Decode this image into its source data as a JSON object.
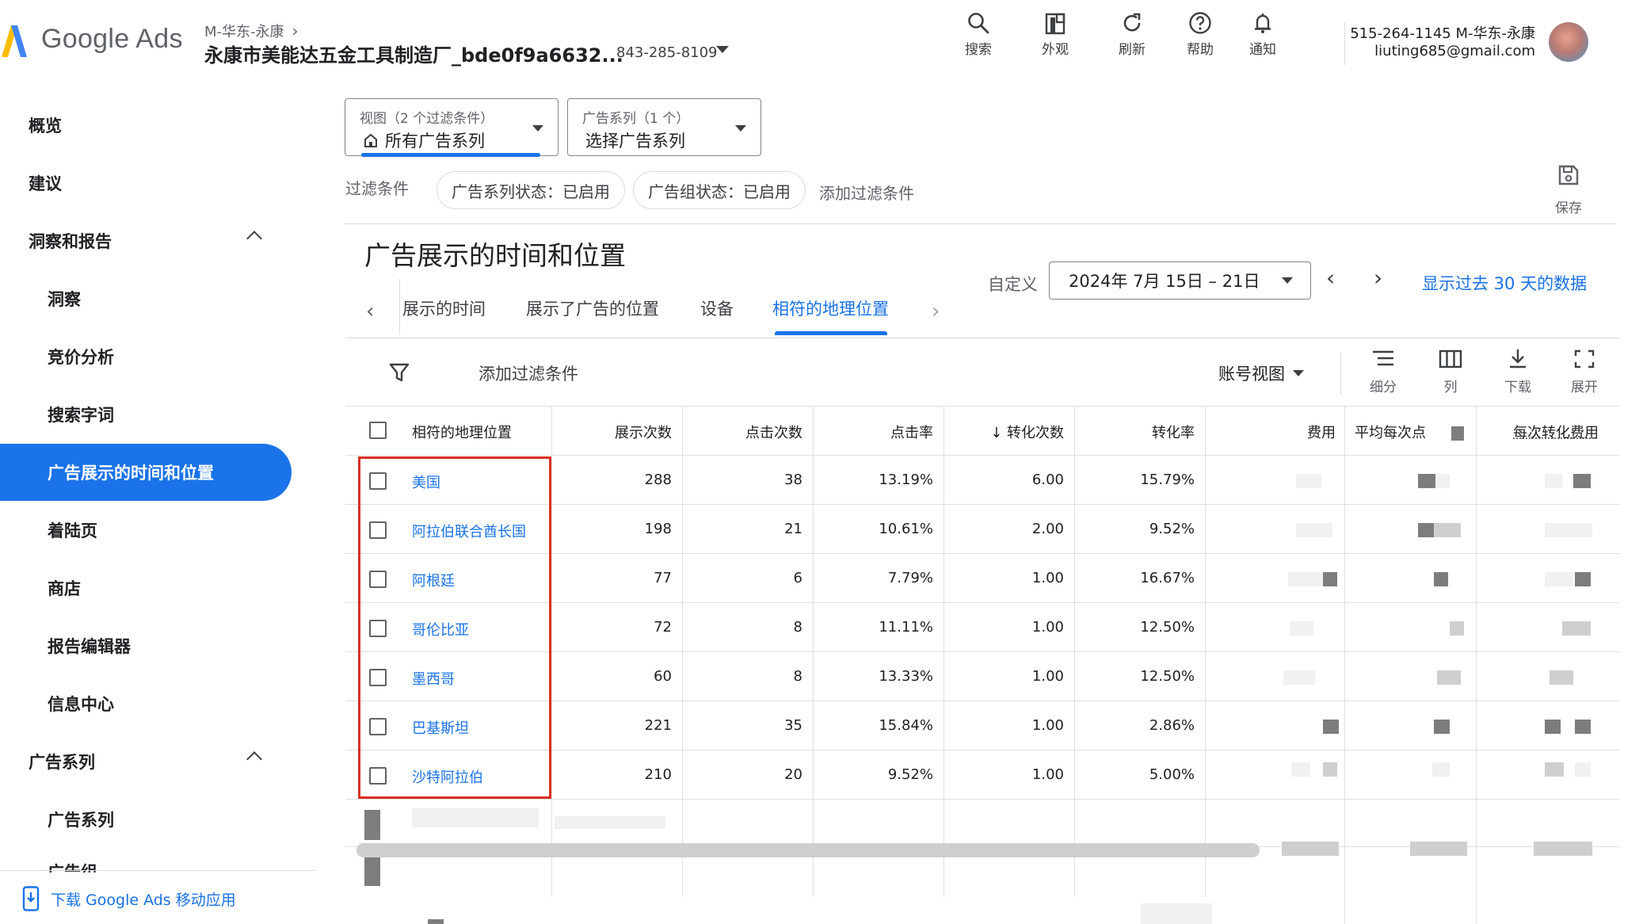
{
  "header": {
    "logo_text": "Google Ads",
    "account_crumb": "M-华东-永康",
    "account_name": "永康市美能达五金工具制造厂_bde0f9a6632...",
    "account_id": "843-285-8109",
    "tools": [
      {
        "label": "搜索",
        "icon": "search-icon"
      },
      {
        "label": "外观",
        "icon": "appearance-icon"
      },
      {
        "label": "刷新",
        "icon": "refresh-icon"
      },
      {
        "label": "帮助",
        "icon": "help-icon"
      },
      {
        "label": "通知",
        "icon": "bell-icon"
      }
    ],
    "user_line1": "515-264-1145 M-华东-永康",
    "user_email": "liuting685@gmail.com"
  },
  "sidebar": {
    "items": [
      {
        "label": "概览"
      },
      {
        "label": "建议"
      },
      {
        "label": "洞察和报告"
      },
      {
        "label": "洞察"
      },
      {
        "label": "竞价分析"
      },
      {
        "label": "搜索字词"
      },
      {
        "label": "广告展示的时间和位置"
      },
      {
        "label": "着陆页"
      },
      {
        "label": "商店"
      },
      {
        "label": "报告编辑器"
      },
      {
        "label": "信息中心"
      },
      {
        "label": "广告系列"
      },
      {
        "label": "广告系列"
      },
      {
        "label": "广告组"
      }
    ],
    "download_app": "下载 Google Ads 移动应用"
  },
  "filters": {
    "view_small": "视图（2 个过滤条件）",
    "view_value": "所有广告系列",
    "campaign_small": "广告系列（1 个）",
    "campaign_value": "选择广告系列",
    "label": "过滤条件",
    "chips": [
      "广告系列状态：已启用",
      "广告组状态：已启用"
    ],
    "add_filter": "添加过滤条件",
    "save_label": "保存"
  },
  "report": {
    "title": "广告展示的时间和位置",
    "tabs": [
      "展示的时间",
      "展示了广告的位置",
      "设备",
      "相符的地理位置"
    ],
    "active_tab": 3,
    "date_prefix": "自定义",
    "date_range": "2024年 7月 15日 – 21日",
    "show_30_days": "显示过去 30 天的数据"
  },
  "toolbar": {
    "add_filter": "添加过滤条件",
    "account_view": "账号视图",
    "segment": "细分",
    "columns": "列",
    "download": "下载",
    "expand": "展开"
  },
  "table": {
    "headers": [
      "相符的地理位置",
      "展示次数",
      "点击次数",
      "点击率",
      "↓ 转化次数",
      "转化率",
      "费用",
      "平均每次点",
      "每次转化费用"
    ],
    "rows": [
      {
        "location": "美国",
        "impressions": "288",
        "clicks": "38",
        "ctr": "13.19%",
        "conversions": "6.00",
        "conv_rate": "15.79%"
      },
      {
        "location": "阿拉伯联合酋长国",
        "impressions": "198",
        "clicks": "21",
        "ctr": "10.61%",
        "conversions": "2.00",
        "conv_rate": "9.52%"
      },
      {
        "location": "阿根廷",
        "impressions": "77",
        "clicks": "6",
        "ctr": "7.79%",
        "conversions": "1.00",
        "conv_rate": "16.67%"
      },
      {
        "location": "哥伦比亚",
        "impressions": "72",
        "clicks": "8",
        "ctr": "11.11%",
        "conversions": "1.00",
        "conv_rate": "12.50%"
      },
      {
        "location": "墨西哥",
        "impressions": "60",
        "clicks": "8",
        "ctr": "13.33%",
        "conversions": "1.00",
        "conv_rate": "12.50%"
      },
      {
        "location": "巴基斯坦",
        "impressions": "221",
        "clicks": "35",
        "ctr": "15.84%",
        "conversions": "1.00",
        "conv_rate": "2.86%"
      },
      {
        "location": "沙特阿拉伯",
        "impressions": "210",
        "clicks": "20",
        "ctr": "9.52%",
        "conversions": "1.00",
        "conv_rate": "5.00%"
      }
    ]
  },
  "colors": {
    "accent": "#1a73e8",
    "highlight": "#d93025"
  }
}
